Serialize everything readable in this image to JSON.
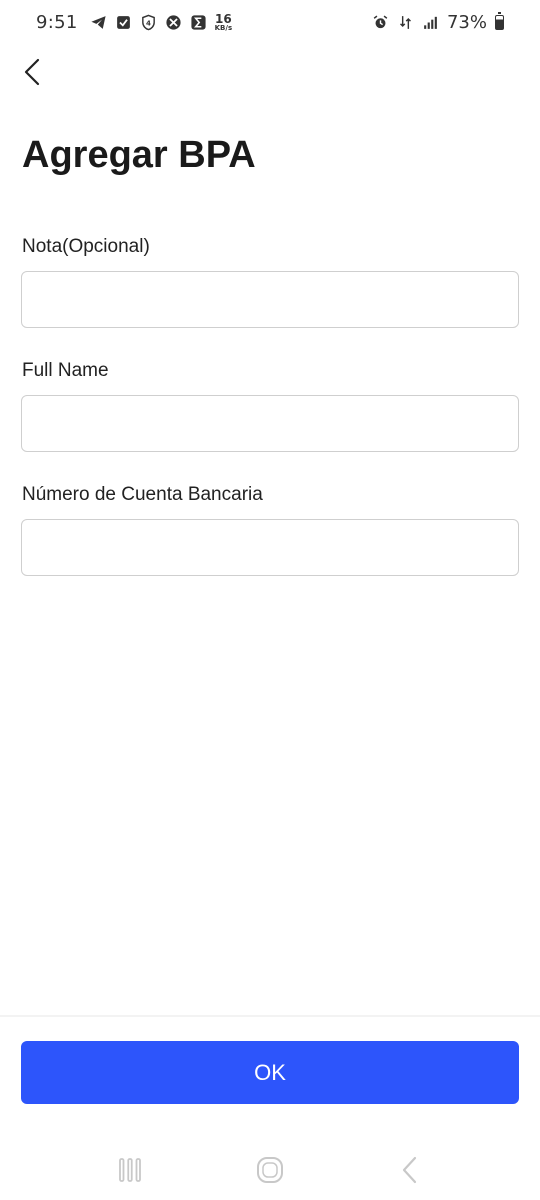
{
  "status_bar": {
    "time": "9:51",
    "net_speed_value": "16",
    "net_speed_unit": "KB/s",
    "battery_percent": "73%",
    "icons_left": [
      "telegram-icon",
      "check-box-icon",
      "shield-four-icon",
      "xbox-icon",
      "sigma-icon"
    ],
    "icons_right": [
      "alarm-icon",
      "data-transfer-icon",
      "signal-icon",
      "battery-icon"
    ]
  },
  "header": {
    "title": "Agregar BPA"
  },
  "form": {
    "fields": [
      {
        "label": "Nota(Opcional)",
        "value": "",
        "placeholder": ""
      },
      {
        "label": "Full Name",
        "value": "",
        "placeholder": ""
      },
      {
        "label": "Número de Cuenta Bancaria",
        "value": "",
        "placeholder": ""
      }
    ]
  },
  "footer": {
    "ok_label": "OK"
  },
  "colors": {
    "accent": "#2d55fb",
    "input_border": "#cfcfcf",
    "text": "#1a1a1a"
  }
}
